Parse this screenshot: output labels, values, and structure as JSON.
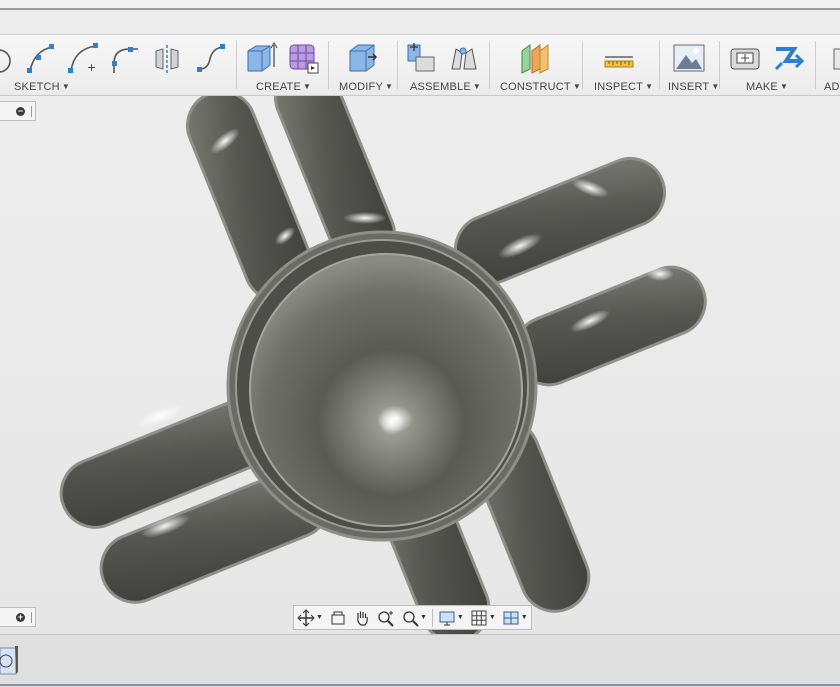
{
  "toolbar": {
    "groups": [
      {
        "label": "SKETCH"
      },
      {
        "label": "CREATE"
      },
      {
        "label": "MODIFY"
      },
      {
        "label": "ASSEMBLE"
      },
      {
        "label": "CONSTRUCT"
      },
      {
        "label": "INSPECT"
      },
      {
        "label": "INSERT"
      },
      {
        "label": "MAKE"
      },
      {
        "label": "AD"
      }
    ]
  },
  "browser": {
    "collapse_symbol": "−",
    "expand_symbol": "+"
  },
  "colors": {
    "model_body": "#5a5b56",
    "canvas_bg": "#ebebeb",
    "accent_blue": "#2f7fd1"
  },
  "icons": [
    "circle-icon",
    "arc-icon",
    "spline-icon",
    "fillet-arc-icon",
    "mirror-icon",
    "curve-icon",
    "box-icon",
    "lattice-icon",
    "press-pull-icon",
    "joint-icon",
    "as-built-joint-icon",
    "offset-plane-icon",
    "measure-icon",
    "insert-image-icon",
    "3d-print-icon",
    "make-arrow-icon",
    "orbit-icon",
    "look-at-icon",
    "pan-icon",
    "zoom-icon",
    "zoom-window-icon",
    "display-settings-icon",
    "grid-icon",
    "viewports-icon"
  ]
}
